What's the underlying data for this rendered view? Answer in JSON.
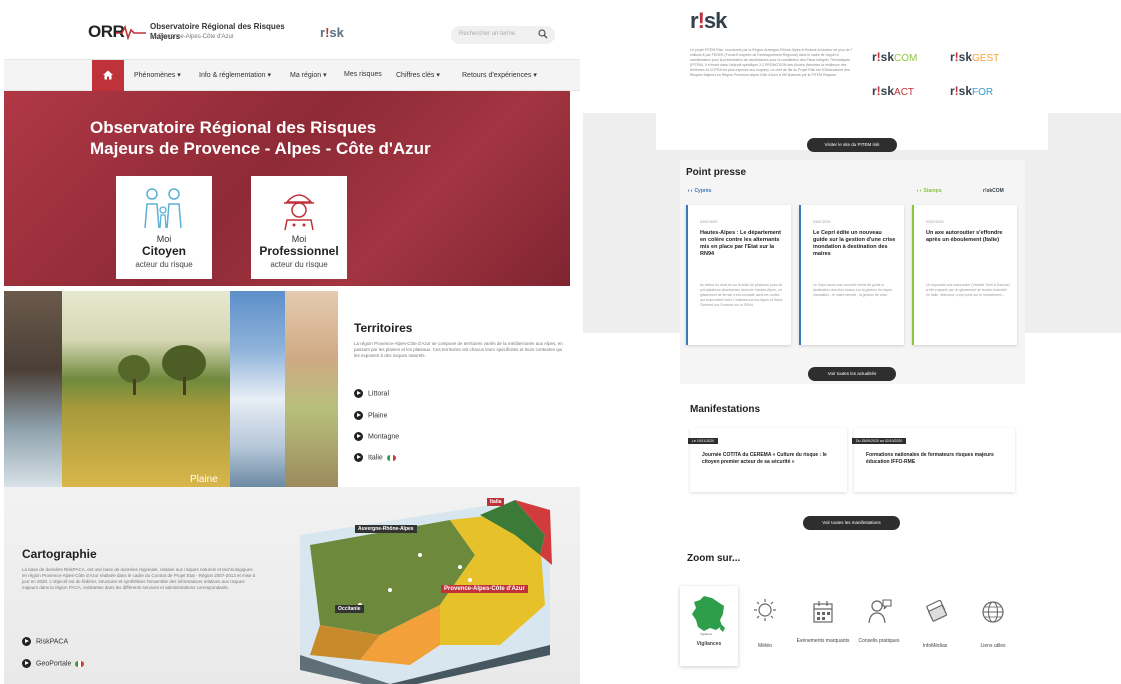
{
  "left": {
    "header": {
      "logo_text": "ORR",
      "title": "Observatoire Régional des Risques Majeurs",
      "subtitle": "en Provence-Alpes-Côte d'Azur",
      "partner_logo": "r!sk",
      "search_placeholder": "Rechercher un terme"
    },
    "nav": {
      "items": [
        "Phénomènes ▾",
        "Info & réglementation ▾",
        "Ma région ▾",
        "Mes risques",
        "Chiffres clés ▾",
        "Retours d'expériences ▾"
      ]
    },
    "hero": {
      "title_line1": "Observatoire Régional des Risques",
      "title_line2": "Majeurs de Provence - Alpes - Côte d'Azur",
      "cards": [
        {
          "moi": "Moi",
          "role": "Citoyen",
          "sub": "acteur du risque"
        },
        {
          "moi": "Moi",
          "role": "Professionnel",
          "sub": "acteur du risque"
        }
      ]
    },
    "territoires": {
      "title": "Territoires",
      "text": "La région Provence-Alpes-Côte d'Azur se compose de territoires variés de la méditerranée aux Alpes, en passant par les plaines et les plateaux. Ces territoires ont chacun leurs spécificités et leurs contextes qui les exposent à des risques naturels.",
      "photo_label": "Plaine",
      "items": [
        "Littoral",
        "Plaine",
        "Montagne",
        "Italie"
      ]
    },
    "cartographie": {
      "title": "Cartographie",
      "text": "La base de données RiskPACA, est une base de données régionale, relative aux risques naturels et technologiques en région Provence-Alpes-Côte d'Azur réalisée dans le cadre du Contrat de Projet Etat - Région 2007-2013 et mise à jour en 2020. L'objectif est de fédérer, structurer et synthétiser l'ensemble des informations relatives aux risques majeurs dans la région PACA, existantes dans les différents services et administrations correspondants.",
      "items": [
        "RiskPACA",
        "GeoPortale"
      ],
      "map_labels": [
        "Italia",
        "Auvergne-Rhône-Alpes",
        "Provence-Alpes-Côte d'Azur",
        "Occitanie"
      ]
    }
  },
  "right": {
    "logo": "r!sk",
    "description": "Le projet PITEM Risk, coordonné par la Région Auvergne-Rhône-Alpes et financé à hauteur de plus de 7 millions € par FEDER (Fonds Européen de Développement Régional) dans le cadre de l'appel à manifestation pour la présentation de candidatures pour la constitution des Plans Intégrés Thématiques (PITEM). Il s'inscrit dans l'objectif spécifique 3.2 PROMOTION des Alcotra (favoriser la résilience des territoires ALCOTRA les plus exposés aux risques). Le chef de file du Projet Risk est l'Observatoire des Risques Majeurs en Région Provence-Alpes-Côte d'Azur à 9M financés par le PITEM Risques.",
    "sub_logos": [
      "r!skCOM",
      "r!skGEST",
      "r!skACT",
      "r!skFOR"
    ],
    "visit_button": "Visiter le site du PITEM risk",
    "point_presse": {
      "title": "Point presse",
      "sources": [
        "Cyprès",
        "Stampa",
        "r!skCOM"
      ],
      "articles": [
        {
          "date": "04/07/2020",
          "headline": "Hautes-Alpes : Le département en colère contre les alternants mis en place par l'Etat sur la RN94",
          "excerpt": "Au début du mois et sur la suite de plusieurs jours de précipitations abondantes dans les Hautes-Alpes, un glissement de terrain s'est constaté dans les routes qui empruntent entre Châteauroux-les-Alpes et Saint-Clément-sur-Durance sur la RN94."
        },
        {
          "date": "03/07/2020",
          "headline": "Le Cepri édite un nouveau guide sur la gestion d'une crise inondation à destination des maires",
          "excerpt": "Le Cepri lance une nouvelle forme de guide à destination des élus locaux sur la gestion du risque inondation : le maire devrait : la gestion de crise."
        },
        {
          "date": "02/07/2020",
          "headline": "Un axe autoroutier s'effondre après un éboulement (Italie)",
          "excerpt": "Un important axe autoroutier (Viadotti Turin à Savone) a été emporté par un glissement de terrain torrentiel en Italie. Manneux, s'est porte sur le ruisselemen..."
        }
      ],
      "all_button": "Voir toutes les actualités"
    },
    "manifestations": {
      "title": "Manifestations",
      "events": [
        {
          "date": "Le 19/11/2020",
          "title": "Journée COTITA du CEREMA « Culture du risque : le citoyen premier acteur de sa sécurité »"
        },
        {
          "date": "Du 25/09/2020 au 02/10/2020",
          "title": "Formations nationales de formateurs risques majeurs éducation IFFO-RME"
        }
      ],
      "all_button": "Voir toutes les manifestations"
    },
    "zoom": {
      "title": "Zoom sur...",
      "items": [
        "Vigilances",
        "Météo",
        "Evénements marquants",
        "Conseils pratiques",
        "InfoMédias",
        "Liens utiles"
      ],
      "vigilance_badge": "Vigilance"
    }
  },
  "colors": {
    "brand_red": "#c0323a",
    "hero_red": "#9a2f3b",
    "dark": "#2e2e2e",
    "press_blue": "#3a78b8",
    "press_green": "#8cc63f"
  }
}
